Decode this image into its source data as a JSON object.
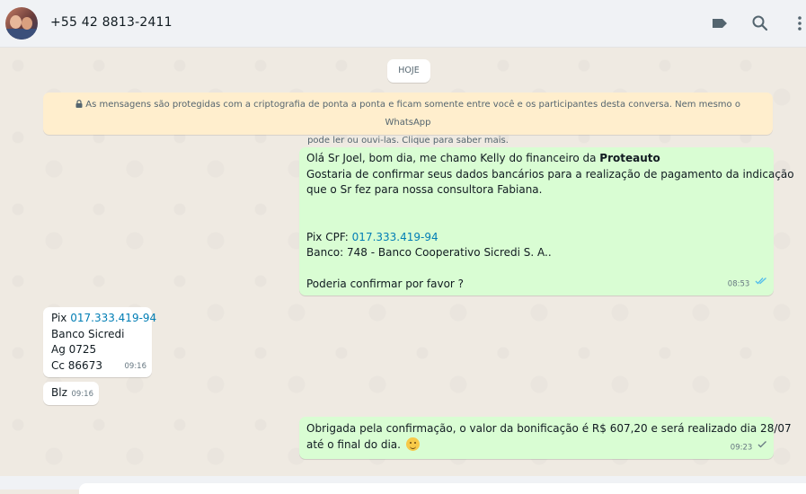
{
  "header": {
    "contact_name": "+55 42 8813-2411",
    "icons": [
      "label-icon",
      "search-icon",
      "menu-icon"
    ]
  },
  "chat": {
    "date_chip": "HOJE",
    "encryption_notice": {
      "line1": "As mensagens são protegidas com a criptografia de ponta a ponta e ficam somente entre você e os participantes desta conversa. Nem mesmo o WhatsApp",
      "line2": "pode ler ou ouvi-las. Clique para saber mais."
    },
    "messages": [
      {
        "direction": "outgoing",
        "greeting_prefix": "Olá Sr Joel, bom dia, me chamo Kelly do financeiro da ",
        "company": "Proteauto",
        "line2": "Gostaria de confirmar seus dados bancários para a realização de pagamento da indicação",
        "line3": "que o Sr fez para nossa consultora Fabiana.",
        "pix_label": "Pix CPF: ",
        "pix_value": "017.333.419-94",
        "bank": "Banco: 748 - Banco Cooperativo Sicredi S. A..",
        "question": "Poderia confirmar por favor ?",
        "time": "08:53",
        "status": "read"
      },
      {
        "direction": "incoming",
        "pix_label": "Pix ",
        "pix_value": "017.333.419-94",
        "bank": "Banco Sicredi",
        "agency": "Ag 0725",
        "account": "Cc 86673",
        "time": "09:16"
      },
      {
        "direction": "incoming",
        "text": "Blz",
        "time": "09:16"
      },
      {
        "direction": "outgoing",
        "line1": "Obrigada pela confirmação, o valor da bonificação é R$ 607,20 e será realizado dia 28/07",
        "line2": "até o final do dia.",
        "emoji": "smiling-face-emoji",
        "time": "09:23",
        "status": "sent"
      }
    ]
  },
  "colors": {
    "outgoing_bubble": "#d9fdd3",
    "incoming_bubble": "#ffffff",
    "link": "#027eb5",
    "read_tick": "#53bdeb",
    "header_bg": "#f0f2f5",
    "encryption_bg": "#ffeecd"
  }
}
